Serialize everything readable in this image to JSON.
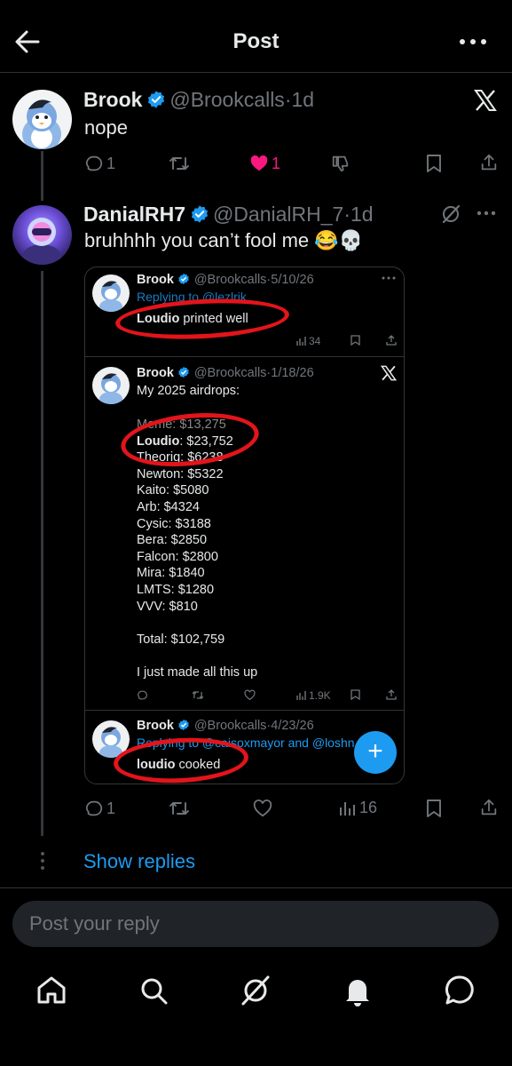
{
  "header": {
    "title": "Post"
  },
  "post1": {
    "name": "Brook",
    "handle": "@Brookcalls",
    "time": "1d",
    "text": "nope",
    "replies": "1",
    "likes": "1"
  },
  "post2": {
    "name": "DanialRH7",
    "handle": "@DanialRH_7",
    "time": "1d",
    "text": "bruhhhh you can’t fool me 😂💀",
    "replies": "1",
    "views": "16"
  },
  "quote1": {
    "name": "Brook",
    "handle": "@Brookcalls",
    "time": "5/10/26",
    "reply_partial": "Replying to @lezlrik",
    "text_bold": "Loudio",
    "text_rest": " printed well",
    "views": "34"
  },
  "quote2": {
    "name": "Brook",
    "handle": "@Brookcalls",
    "time": "1/18/26",
    "heading": "My 2025 airdrops:",
    "struck_line": "Meme: $13,275",
    "loudio_bold": "Loudio",
    "loudio_rest": ": $23,752",
    "theoriq": "Theoriq: $6238",
    "lines": [
      "Newton: $5322",
      "Kaito: $5080",
      "Arb: $4324",
      "Cysic: $3188",
      "Bera: $2850",
      "Falcon: $2800",
      "Mira: $1840",
      "LMTS: $1280",
      "VVV: $810"
    ],
    "total": "Total: $102,759",
    "footer": "I just made all this up",
    "views": "1.9K"
  },
  "quote3": {
    "name": "Brook",
    "handle": "@Brookcalls",
    "time": "4/23/26",
    "reply_line": "Replying to @caisoxmayor and @loshn",
    "text_bold": "loudio",
    "text_rest": " cooked"
  },
  "show_replies": "Show replies",
  "reply": {
    "placeholder": "Post your reply"
  },
  "colors": {
    "accent": "#1d9bf0",
    "like": "#f91880",
    "circle": "#e3141b",
    "background": "#000000"
  },
  "icons": [
    "back-arrow-icon",
    "more-icon",
    "x-logo-icon",
    "verified-badge-icon",
    "reply-icon",
    "repost-icon",
    "heart-icon",
    "dislike-icon",
    "bookmark-icon",
    "share-icon",
    "grok-icon",
    "views-icon",
    "plus-icon",
    "home-icon",
    "search-icon",
    "bell-icon",
    "messages-icon"
  ]
}
